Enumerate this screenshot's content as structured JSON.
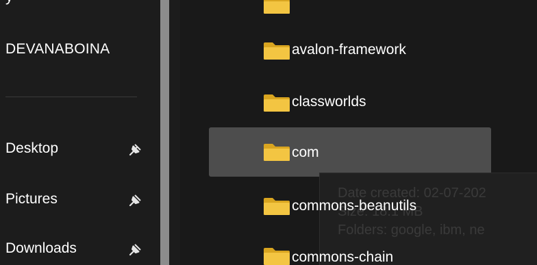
{
  "sidebar": {
    "account_label": "DEVANABOINA",
    "quick_access": [
      {
        "label": "Desktop",
        "icon": "pin-icon"
      },
      {
        "label": "Pictures",
        "icon": "pin-icon"
      },
      {
        "label": "Downloads",
        "icon": "pin-icon"
      }
    ]
  },
  "content": {
    "folders": [
      {
        "name": "avalon-framework",
        "icon": "folder-icon"
      },
      {
        "name": "classworlds",
        "icon": "folder-icon"
      },
      {
        "name": "com",
        "icon": "folder-icon",
        "selected": true
      },
      {
        "name": "commons-beanutils",
        "icon": "folder-icon"
      },
      {
        "name": "commons-chain",
        "icon": "folder-icon"
      }
    ]
  },
  "tooltip": {
    "date_created": "Date created: 02-07-202",
    "size": "Size: 18.1 MB",
    "folders": "Folders: google, ibm, ne"
  },
  "colors": {
    "background": "#1c1c1c",
    "selection": "#4d4d4d",
    "folder_yellow": "#f3c542",
    "splitter": "#8c8c8c"
  }
}
